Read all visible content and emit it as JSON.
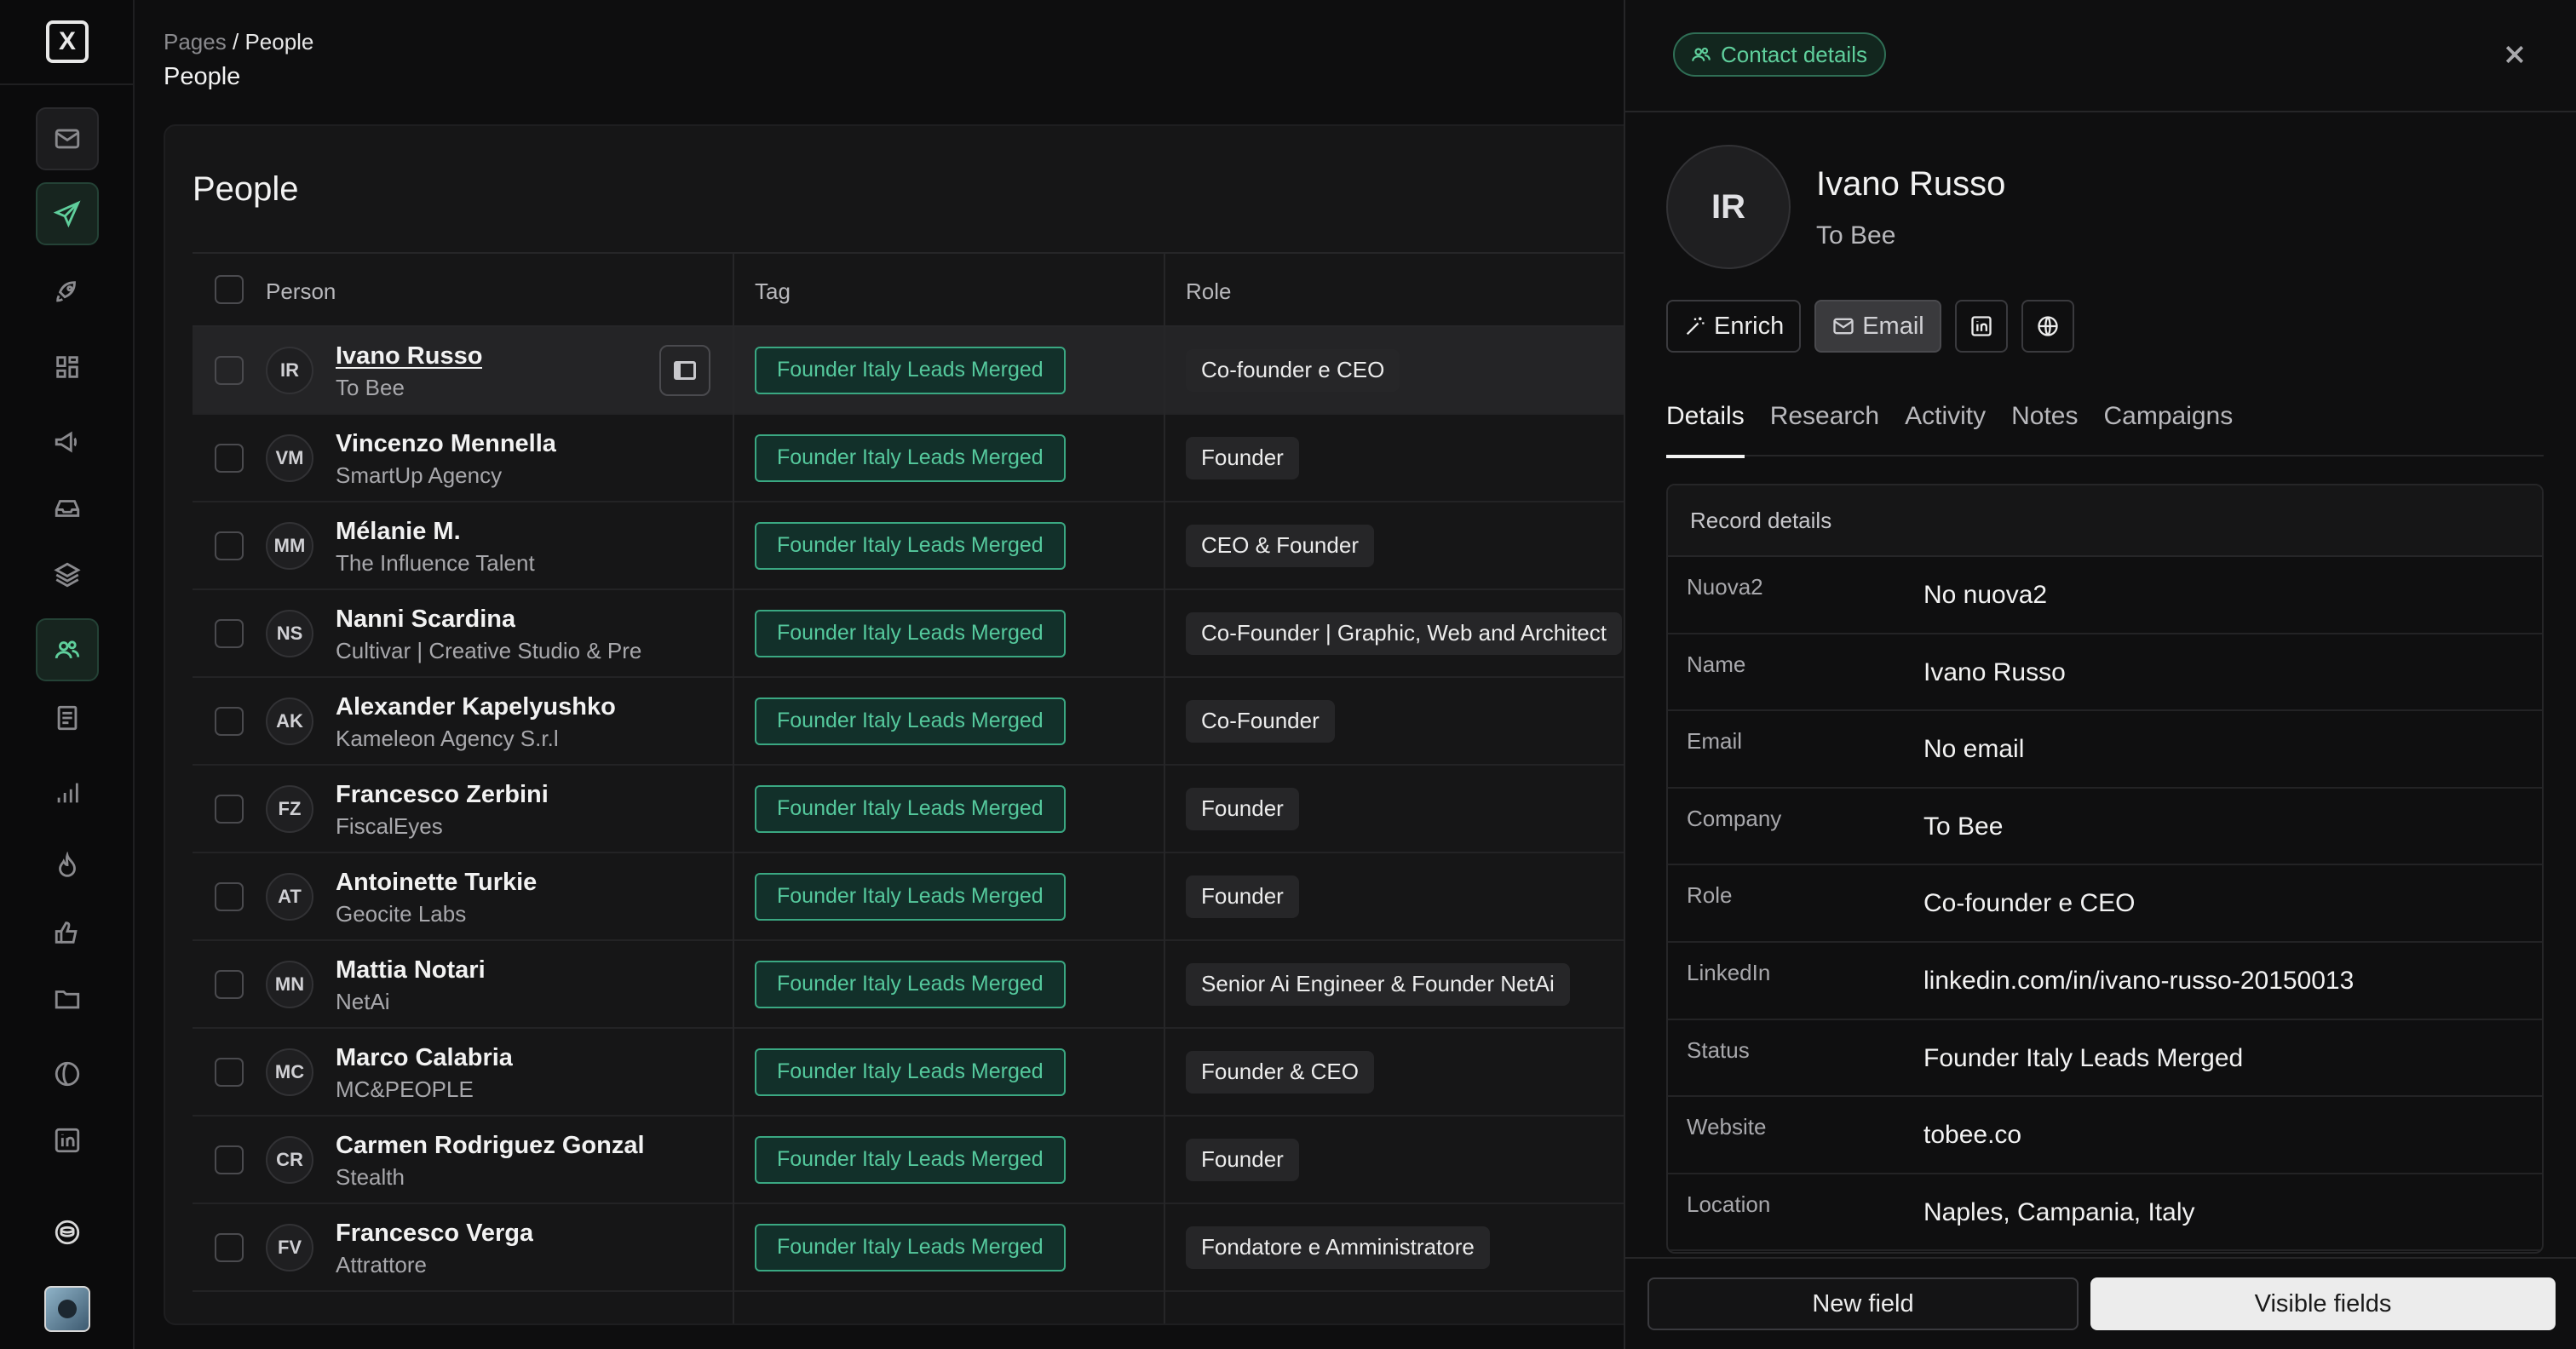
{
  "sidebar": {
    "logo": "X",
    "items": [
      {
        "name": "mail-icon"
      },
      {
        "name": "send-icon"
      },
      {
        "name": "rocket-icon"
      },
      {
        "name": "grid-icon"
      },
      {
        "name": "megaphone-icon"
      },
      {
        "name": "inbox-icon"
      },
      {
        "name": "layers-icon"
      },
      {
        "name": "people-icon"
      },
      {
        "name": "document-icon"
      },
      {
        "name": "bar-chart-icon"
      },
      {
        "name": "flame-icon"
      },
      {
        "name": "thumbs-up-icon"
      },
      {
        "name": "folder-icon"
      },
      {
        "name": "globe-icon"
      },
      {
        "name": "linkedin-icon"
      },
      {
        "name": "coins-icon"
      }
    ]
  },
  "header": {
    "breadcrumb_root": "Pages",
    "breadcrumb_sep": "/",
    "breadcrumb_current": "People",
    "title": "People"
  },
  "table": {
    "title": "People",
    "columns": {
      "person": "Person",
      "tag": "Tag",
      "role": "Role"
    },
    "rows": [
      {
        "initials": "IR",
        "name": "Ivano Russo",
        "company": "To Bee",
        "tag": "Founder Italy Leads Merged",
        "role": "Co-founder e CEO"
      },
      {
        "initials": "VM",
        "name": "Vincenzo Mennella",
        "company": "SmartUp Agency",
        "tag": "Founder Italy Leads Merged",
        "role": "Founder"
      },
      {
        "initials": "MM",
        "name": "Mélanie M.",
        "company": "The Influence Talent",
        "tag": "Founder Italy Leads Merged",
        "role": "CEO & Founder"
      },
      {
        "initials": "NS",
        "name": "Nanni Scardina",
        "company": "Cultivar | Creative Studio & Pre",
        "tag": "Founder Italy Leads Merged",
        "role": "Co-Founder | Graphic, Web and Architect"
      },
      {
        "initials": "AK",
        "name": "Alexander Kapelyushko",
        "company": "Kameleon Agency S.r.l",
        "tag": "Founder Italy Leads Merged",
        "role": "Co-Founder"
      },
      {
        "initials": "FZ",
        "name": "Francesco Zerbini",
        "company": "FiscalEyes",
        "tag": "Founder Italy Leads Merged",
        "role": "Founder"
      },
      {
        "initials": "AT",
        "name": "Antoinette Turkie",
        "company": "Geocite Labs",
        "tag": "Founder Italy Leads Merged",
        "role": "Founder"
      },
      {
        "initials": "MN",
        "name": "Mattia Notari",
        "company": "NetAi",
        "tag": "Founder Italy Leads Merged",
        "role": "Senior Ai Engineer & Founder NetAi"
      },
      {
        "initials": "MC",
        "name": "Marco Calabria",
        "company": "MC&PEOPLE",
        "tag": "Founder Italy Leads Merged",
        "role": "Founder & CEO"
      },
      {
        "initials": "CR",
        "name": "Carmen Rodriguez Gonzal",
        "company": "Stealth",
        "tag": "Founder Italy Leads Merged",
        "role": "Founder"
      },
      {
        "initials": "FV",
        "name": "Francesco Verga",
        "company": "Attrattore",
        "tag": "Founder Italy Leads Merged",
        "role": "Fondatore e Amministratore"
      }
    ]
  },
  "panel": {
    "badge": "Contact details",
    "initials": "IR",
    "name": "Ivano Russo",
    "company": "To Bee",
    "actions": {
      "enrich": "Enrich",
      "email": "Email"
    },
    "tabs": [
      "Details",
      "Research",
      "Activity",
      "Notes",
      "Campaigns"
    ],
    "record": {
      "title": "Record details",
      "fields": [
        {
          "label": "Nuova2",
          "value": "No nuova2"
        },
        {
          "label": "Name",
          "value": "Ivano Russo"
        },
        {
          "label": "Email",
          "value": "No email"
        },
        {
          "label": "Company",
          "value": "To Bee"
        },
        {
          "label": "Role",
          "value": "Co-founder e CEO"
        },
        {
          "label": "LinkedIn",
          "value": "linkedin.com/in/ivano-russo-20150013"
        },
        {
          "label": "Status",
          "value": "Founder Italy Leads Merged"
        },
        {
          "label": "Website",
          "value": "tobee.co"
        },
        {
          "label": "Location",
          "value": "Naples, Campania, Italy"
        }
      ]
    },
    "footer": {
      "new_field": "New field",
      "visible_fields": "Visible fields"
    }
  },
  "colors": {
    "accent": "#5fcf9c",
    "tag_border": "#3aa882",
    "background": "#0e0e0f"
  }
}
